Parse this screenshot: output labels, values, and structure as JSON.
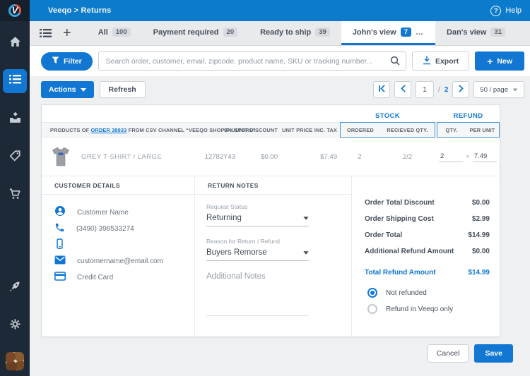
{
  "colors": {
    "accent": "#1177d3",
    "topbar": "#0c7bcb",
    "sidebar": "#1d2936",
    "active_tab_underline": "#1177d3"
  },
  "topbar": {
    "breadcrumb": "Veeqo > Returns",
    "help_label": "Help"
  },
  "tabs": {
    "items": [
      {
        "label": "All",
        "count": "100"
      },
      {
        "label": "Payment required",
        "count": "20"
      },
      {
        "label": "Ready to ship",
        "count": "39"
      },
      {
        "label": "John's view",
        "count": "7",
        "more": "…"
      },
      {
        "label": "Dan's view",
        "count": "31"
      }
    ]
  },
  "toolbar": {
    "filter_label": "Filter",
    "search_placeholder": "Search order, customer, email, zipcode, product name, SKU or tracking number...",
    "export_label": "Export",
    "new_plus": "+",
    "new_label": "New"
  },
  "actionsbar": {
    "actions_label": "Actions",
    "refresh_label": "Refresh",
    "pagination": {
      "current_page": "1",
      "separator": "/",
      "total_pages": "2",
      "page_size": "50 / page"
    }
  },
  "table": {
    "group_headers": {
      "stock": "STOCK",
      "refund": "REFUND"
    },
    "products_header": {
      "prefix": "PRODUCTS OF",
      "order_link": "ORDER 38933",
      "suffix": "FROM CSV CHANNEL “VEEQO SHOPIFY STORE”"
    },
    "columns": {
      "sku": "SKU",
      "unit_discount": "UNIT DISCOUNT",
      "unit_price": "UNIT PRICE INC. TAX",
      "ordered": "ORDERED",
      "received": "RECIEVED QTY.",
      "qty": "QTY.",
      "per_unit": "PER UNIT"
    },
    "row": {
      "product_name": "GREY T-SHIRT / LARGE",
      "sku": "12782Y43",
      "unit_discount": "$0.00",
      "unit_price": "$7.49",
      "ordered": "2",
      "received": "2/2",
      "refund_qty": "2",
      "multiply": "×",
      "refund_per_unit": "7.49"
    }
  },
  "customer": {
    "header": "CUSTOMER DETAILS",
    "items": [
      {
        "icon": "user",
        "label": "Customer Name"
      },
      {
        "icon": "phone",
        "label": "(3490) 398533274"
      },
      {
        "icon": "mobile",
        "label": ""
      },
      {
        "icon": "email",
        "label": "customername@email.com"
      },
      {
        "icon": "credit-card",
        "label": "Credit Card"
      }
    ]
  },
  "return_notes": {
    "header": "RETURN NOTES",
    "request_status_label": "Request Status",
    "request_status_value": "Returning",
    "reason_label": "Reason for Return / Refund",
    "reason_value": "Buyers Remorse",
    "notes_placeholder": "Additional Notes"
  },
  "summary": {
    "rows": [
      {
        "label": "Order Total Discount",
        "value": "$0.00"
      },
      {
        "label": "Order Shipping Cost",
        "value": "$2.99"
      },
      {
        "label": "Order Total",
        "value": "$14.99"
      },
      {
        "label": "Additional Refund Amount",
        "value": "$0.00"
      }
    ],
    "total": {
      "label": "Total Refund Amount",
      "value": "$14.99"
    },
    "radios": [
      {
        "label": "Not refunded",
        "selected": true
      },
      {
        "label": "Refund in Veeqo only",
        "selected": false
      }
    ]
  },
  "footer": {
    "cancel_label": "Cancel",
    "save_label": "Save"
  }
}
